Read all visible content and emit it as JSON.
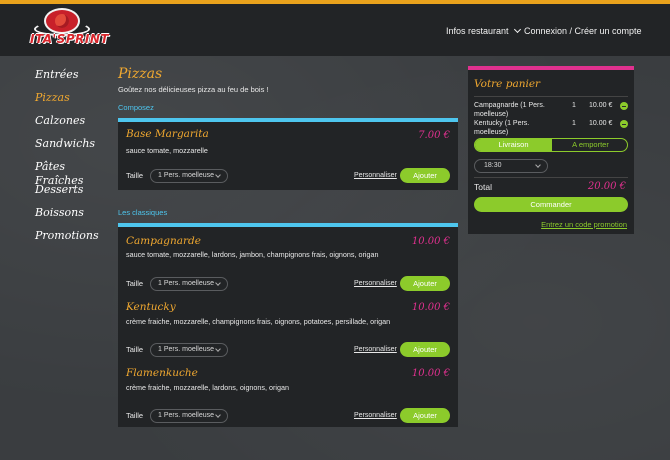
{
  "header": {
    "logo_text": "ITA'SPRINT",
    "nav_info": "Infos restaurant",
    "nav_login": "Connexion / Créer un compte"
  },
  "sidebar": {
    "items": [
      {
        "label": "Entrées",
        "active": false
      },
      {
        "label": "Pizzas",
        "active": true
      },
      {
        "label": "Calzones",
        "active": false
      },
      {
        "label": "Sandwichs",
        "active": false
      },
      {
        "label": "Pâtes Fraîches",
        "active": false
      },
      {
        "label": "Desserts",
        "active": false
      },
      {
        "label": "Boissons",
        "active": false
      },
      {
        "label": "Promotions",
        "active": false
      }
    ]
  },
  "main": {
    "title": "Pizzas",
    "description": "Goûtez nos délicieuses pizza au feu de bois !",
    "sections": [
      {
        "label": "Composez",
        "items": [
          {
            "name": "Base Margarita",
            "price": "7.00 €",
            "description": "sauce tomate, mozzarelle",
            "size_label": "Taille",
            "size": "1 Pers. moelleuse",
            "custom": "Personnaliser",
            "add": "Ajouter"
          }
        ]
      },
      {
        "label": "Les classiques",
        "items": [
          {
            "name": "Campagnarde",
            "price": "10.00 €",
            "description": "sauce tomate, mozzarelle, lardons, jambon, champignons frais, oignons, origan",
            "size_label": "Taille",
            "size": "1 Pers. moelleuse",
            "custom": "Personnaliser",
            "add": "Ajouter"
          },
          {
            "name": "Kentucky",
            "price": "10.00 €",
            "description": "crème fraiche, mozzarelle, champignons frais, oignons, potatoes, persillade, origan",
            "size_label": "Taille",
            "size": "1 Pers. moelleuse",
            "custom": "Personnaliser",
            "add": "Ajouter"
          },
          {
            "name": "Flamenkuche",
            "price": "10.00 €",
            "description": "crème fraiche, mozzarelle, lardons, oignons, origan",
            "size_label": "Taille",
            "size": "1 Pers. moelleuse",
            "custom": "Personnaliser",
            "add": "Ajouter"
          }
        ]
      }
    ]
  },
  "cart": {
    "title": "Votre panier",
    "lines": [
      {
        "name": "Campagnarde (1 Pers. moelleuse)",
        "qty": "1",
        "price": "10.00 €"
      },
      {
        "name": "Kentucky (1 Pers. moelleuse)",
        "qty": "1",
        "price": "10.00 €"
      }
    ],
    "delivery_on": "Livraison",
    "delivery_off": "A emporter",
    "time": "18:30",
    "total_label": "Total",
    "total_value": "20.00 €",
    "order_button": "Commander",
    "promo_link": "Entrez un code promotion"
  },
  "colors": {
    "accent_orange": "#f0a830",
    "accent_blue": "#4ec6ee",
    "accent_pink": "#e0318f",
    "accent_green": "#8ccb2b",
    "top_bar": "#e9a21c"
  }
}
